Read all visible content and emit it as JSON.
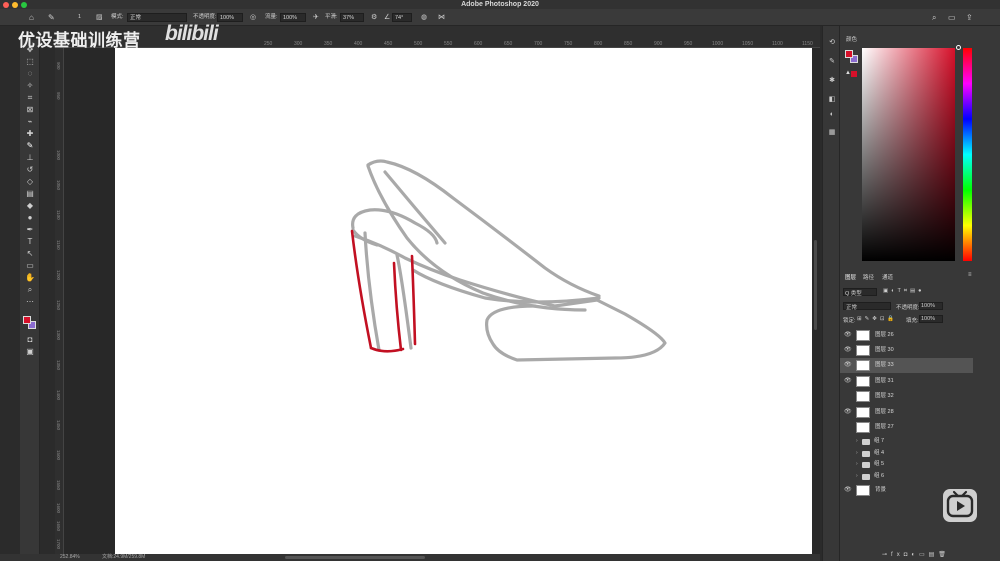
{
  "window": {
    "title": "Adobe Photoshop 2020",
    "traffic_colors": [
      "#fe5f57",
      "#febc2e",
      "#28c840"
    ]
  },
  "options_bar": {
    "mode_label": "模式:",
    "mode_value": "正常",
    "opacity_label": "不透明度:",
    "opacity_value": "100%",
    "flow_label": "流量:",
    "flow_value": "100%",
    "smoothing_label": "平滑:",
    "smoothing_value": "37%",
    "angle_value": "74°",
    "brush_size": "1"
  },
  "watermark": {
    "text": "优设基础训练营",
    "logo": "bilibili"
  },
  "ruler_top_ticks": [
    "250",
    "300",
    "350",
    "400",
    "450",
    "500",
    "550",
    "600",
    "650",
    "700",
    "750",
    "800",
    "850",
    "900",
    "950",
    "1000",
    "1050",
    "1100",
    "1150"
  ],
  "ruler_left_ticks": [
    "900",
    "950",
    "1000",
    "1050",
    "1100",
    "1150",
    "1200",
    "1250",
    "1300",
    "1350",
    "1400",
    "1450",
    "1500",
    "1550",
    "1600",
    "1650",
    "1700"
  ],
  "status": {
    "zoom": "252.84%",
    "doc": "文档:24.9M/259.8M"
  },
  "color_panel": {
    "tab": "颜色",
    "foreground": "#d7102a",
    "background": "#8a6bd0"
  },
  "layers_panel": {
    "tabs": [
      "图层",
      "路径",
      "通道"
    ],
    "filter_label": "Q 类型",
    "blend_mode": "正常",
    "opacity_label": "不透明度:",
    "opacity_value": "100%",
    "lock_label": "锁定:",
    "fill_label": "填充:",
    "fill_value": "100%",
    "layers": [
      {
        "name": "图层 26",
        "visible": true,
        "selected": false
      },
      {
        "name": "图层 30",
        "visible": true,
        "selected": false
      },
      {
        "name": "图层 33",
        "visible": true,
        "selected": true
      },
      {
        "name": "图层 31",
        "visible": true,
        "selected": false
      },
      {
        "name": "图层 32",
        "visible": false,
        "selected": false
      },
      {
        "name": "图层 28",
        "visible": true,
        "selected": false
      },
      {
        "name": "图层 27",
        "visible": false,
        "selected": false
      }
    ],
    "groups": [
      {
        "name": "组 7"
      },
      {
        "name": "组 4"
      },
      {
        "name": "组 5"
      },
      {
        "name": "组 6"
      }
    ],
    "background_layer": "背景"
  }
}
